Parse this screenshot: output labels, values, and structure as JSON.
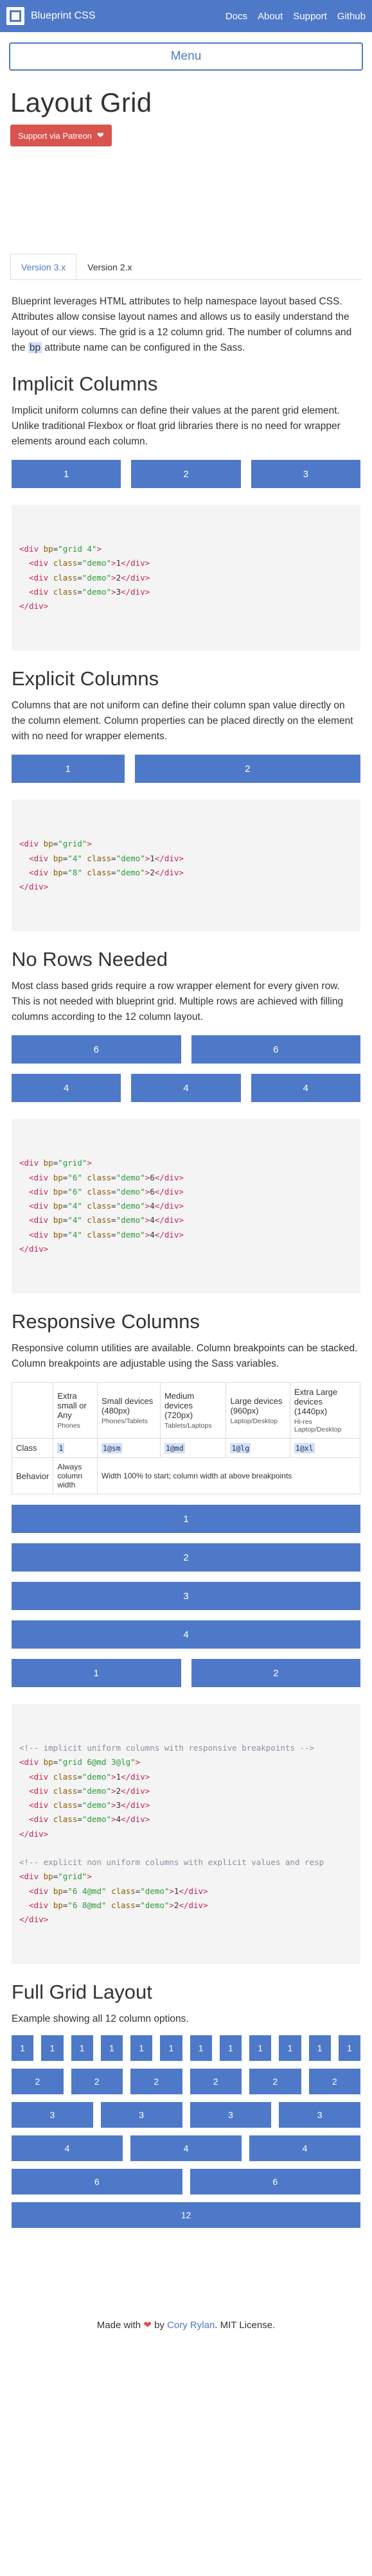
{
  "header": {
    "brand": "Blueprint CSS",
    "nav": [
      "Docs",
      "About",
      "Support",
      "Github"
    ],
    "menu_label": "Menu"
  },
  "page": {
    "title": "Layout Grid",
    "patreon_label": "Support via Patreon",
    "tabs": [
      "Version 3.x",
      "Version 2.x"
    ],
    "intro_before": "Blueprint leverages HTML attributes to help namespace layout based CSS. Attributes allow consise layout names and allows us to easily understand the layout of our views. The grid is a 12 column grid. The number of columns and the ",
    "intro_highlight": "bp",
    "intro_after": " attribute name can be configured in the Sass."
  },
  "implicit": {
    "title": "Implicit Columns",
    "text": "Implicit uniform columns can define their values at the parent grid element. Unlike traditional Flexbox or float grid libraries there is no need for wrapper elements around each column.",
    "demos": [
      "1",
      "2",
      "3"
    ]
  },
  "explicit": {
    "title": "Explicit Columns",
    "text": "Columns that are not uniform can define their column span value directly on the column element. Column properties can be placed directly on the element with no need for wrapper elements.",
    "demos": [
      "1",
      "2"
    ]
  },
  "norows": {
    "title": "No Rows Needed",
    "text": "Most class based grids require a row wrapper element for every given row. This is not needed with blueprint grid. Multiple rows are achieved with filling columns according to the 12 column layout.",
    "row1": [
      "6",
      "6"
    ],
    "row2": [
      "4",
      "4",
      "4"
    ]
  },
  "responsive": {
    "title": "Responsive Columns",
    "text": "Responsive column utilities are available. Column breakpoints can be stacked. Column breakpoints are adjustable using the Sass variables.",
    "table": {
      "headers": [
        {
          "title": "Extra small or Any",
          "sub": "Phones"
        },
        {
          "title": "Small devices (480px)",
          "sub": "Phones/Tablets"
        },
        {
          "title": "Medium devices (720px)",
          "sub": "Tablets/Laptops"
        },
        {
          "title": "Large devices (960px)",
          "sub": "Laptop/Desktop"
        },
        {
          "title": "Extra Large devices (1440px)",
          "sub": "Hi-res Laptop/Desktop"
        }
      ],
      "class_label": "Class",
      "classes": [
        "1",
        "1@sm",
        "1@md",
        "1@lg",
        "1@xl"
      ],
      "behavior_label": "Behavior",
      "behavior_first": "Always column width",
      "behavior_rest": "Width 100% to start; column width at above breakpoints"
    },
    "demos_full": [
      "1",
      "2",
      "3",
      "4"
    ],
    "demos_half": [
      "1",
      "2"
    ]
  },
  "fullgrid": {
    "title": "Full Grid Layout",
    "text": "Example showing all 12 column options.",
    "rows": [
      [
        "1",
        "1",
        "1",
        "1",
        "1",
        "1",
        "1",
        "1",
        "1",
        "1",
        "1",
        "1"
      ],
      [
        "2",
        "2",
        "2",
        "2",
        "2",
        "2"
      ],
      [
        "3",
        "3",
        "3",
        "3"
      ],
      [
        "4",
        "4",
        "4"
      ],
      [
        "6",
        "6"
      ],
      [
        "12"
      ]
    ]
  },
  "footer": {
    "made_with": "Made with",
    "by": "by",
    "author": "Cory Rylan",
    "license": ". MIT License."
  },
  "colors": {
    "primary": "#4e79c9",
    "patreon": "#d9534f",
    "code_bg": "#f4f4f4"
  }
}
